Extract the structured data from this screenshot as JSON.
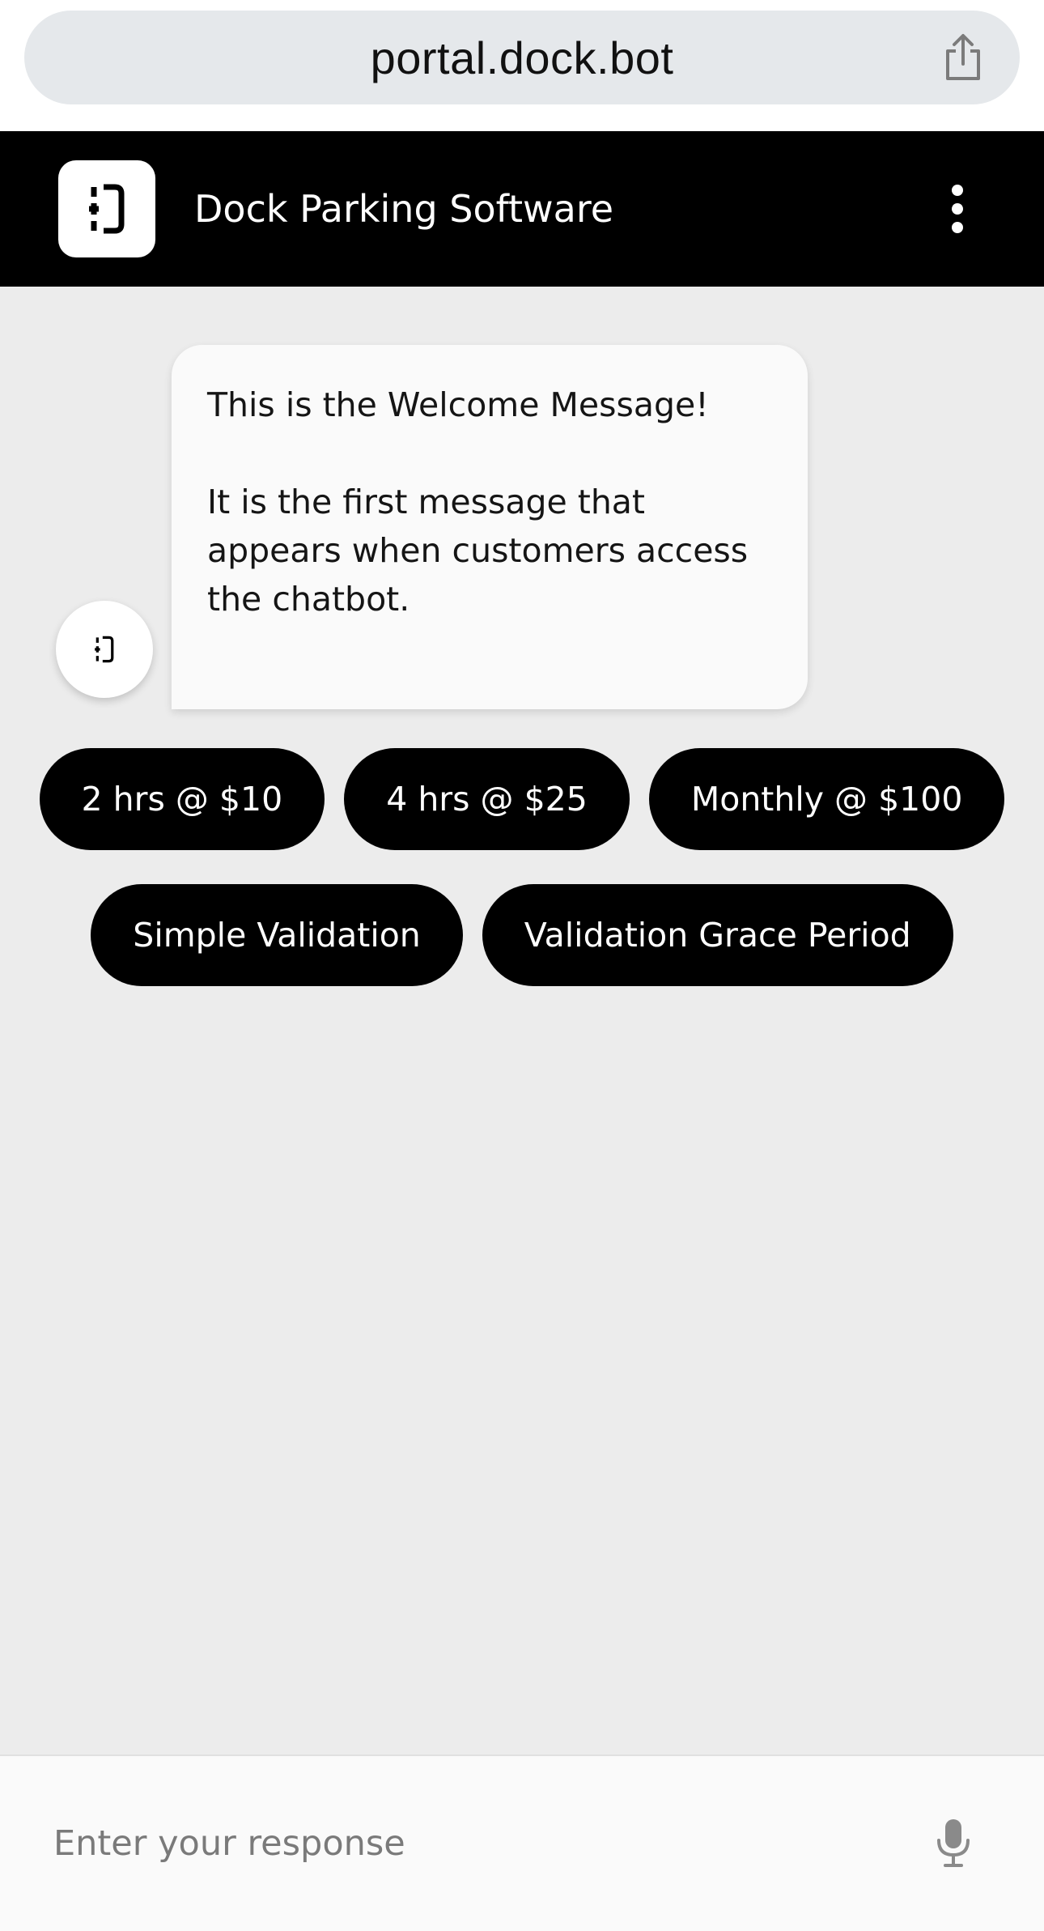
{
  "browser": {
    "url": "portal.dock.bot",
    "share_icon": "share-icon"
  },
  "header": {
    "title": "Dock Parking Software",
    "logo_icon": "dock-logo-icon",
    "menu_icon": "kebab-menu-icon",
    "background": "#000000"
  },
  "chat": {
    "bot_avatar_icon": "dock-logo-icon",
    "welcome_line1": "This is the Welcome Message!",
    "welcome_line2": "It is the first message that appears when customers access the chatbot.",
    "quick_replies": [
      "2 hrs @ $10",
      "4 hrs @ $25",
      "Monthly @ $100",
      "Simple Validation",
      "Validation Grace Period"
    ]
  },
  "input": {
    "placeholder": "Enter your response",
    "mic_icon": "microphone-icon"
  },
  "colors": {
    "chat_background": "#ececec",
    "chip_background": "#000000",
    "chip_text": "#ffffff",
    "bubble_background": "#fafafa"
  }
}
